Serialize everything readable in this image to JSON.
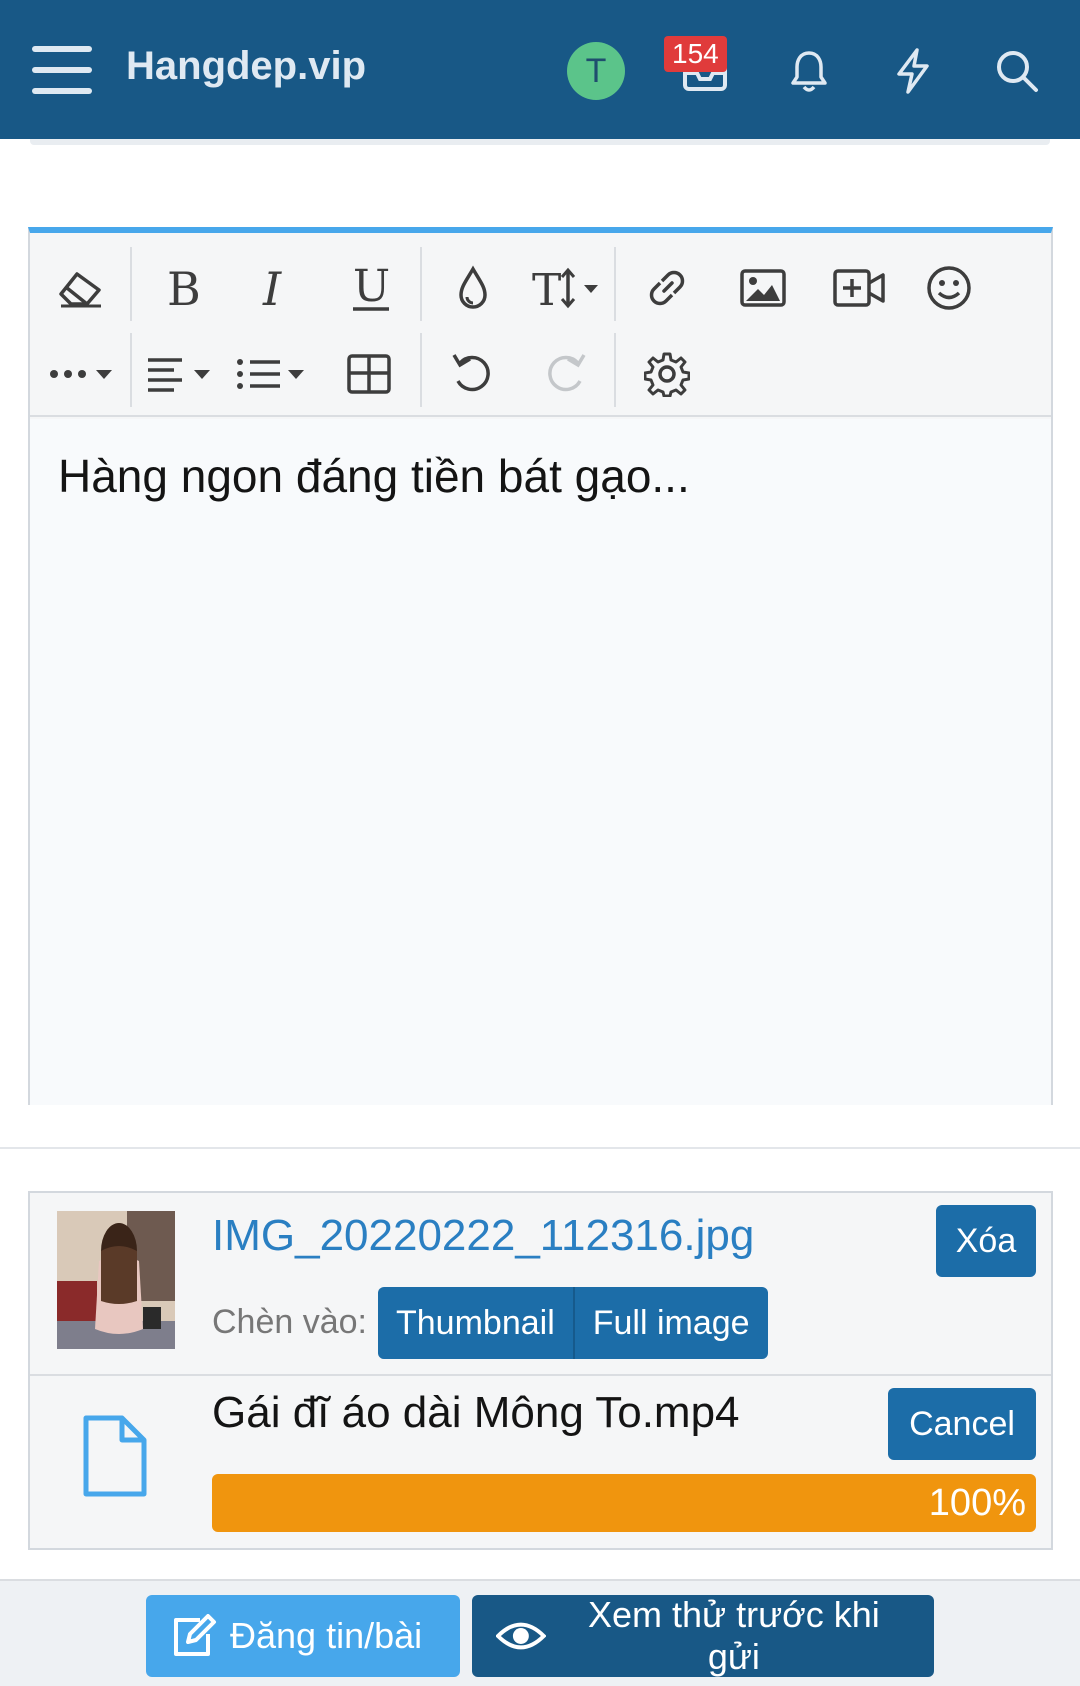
{
  "header": {
    "brand": "Hangdep.vip",
    "avatar_letter": "T",
    "badge_count": "154",
    "icons": [
      "menu-icon",
      "inbox-icon",
      "bell-icon",
      "bolt-icon",
      "search-icon"
    ]
  },
  "editor": {
    "content": "Hàng ngon đáng tiền bát gạo...",
    "toolbar_icons": [
      "eraser-icon",
      "bold-icon",
      "italic-icon",
      "underline-icon",
      "color-drop-icon",
      "font-size-icon",
      "link-icon",
      "image-icon",
      "video-icon",
      "smiley-icon",
      "more-icon",
      "align-icon",
      "list-icon",
      "table-icon",
      "undo-icon",
      "redo-icon",
      "gear-icon"
    ]
  },
  "attachments": {
    "image": {
      "filename": "IMG_20220222_112316.jpg",
      "delete_label": "Xóa",
      "insert_label": "Chèn vào:",
      "thumbnail_label": "Thumbnail",
      "full_image_label": "Full image"
    },
    "video": {
      "filename": "Gái đĩ áo dài Mông To.mp4",
      "cancel_label": "Cancel",
      "progress": 100,
      "progress_label": "100%"
    }
  },
  "footer": {
    "post_label": "Đăng tin/bài",
    "preview_label": "Xem thử trước khi gửi"
  },
  "colors": {
    "header": "#185886",
    "accent": "#47a7eb",
    "button": "#1c6da8",
    "progress": "#f0950e"
  }
}
